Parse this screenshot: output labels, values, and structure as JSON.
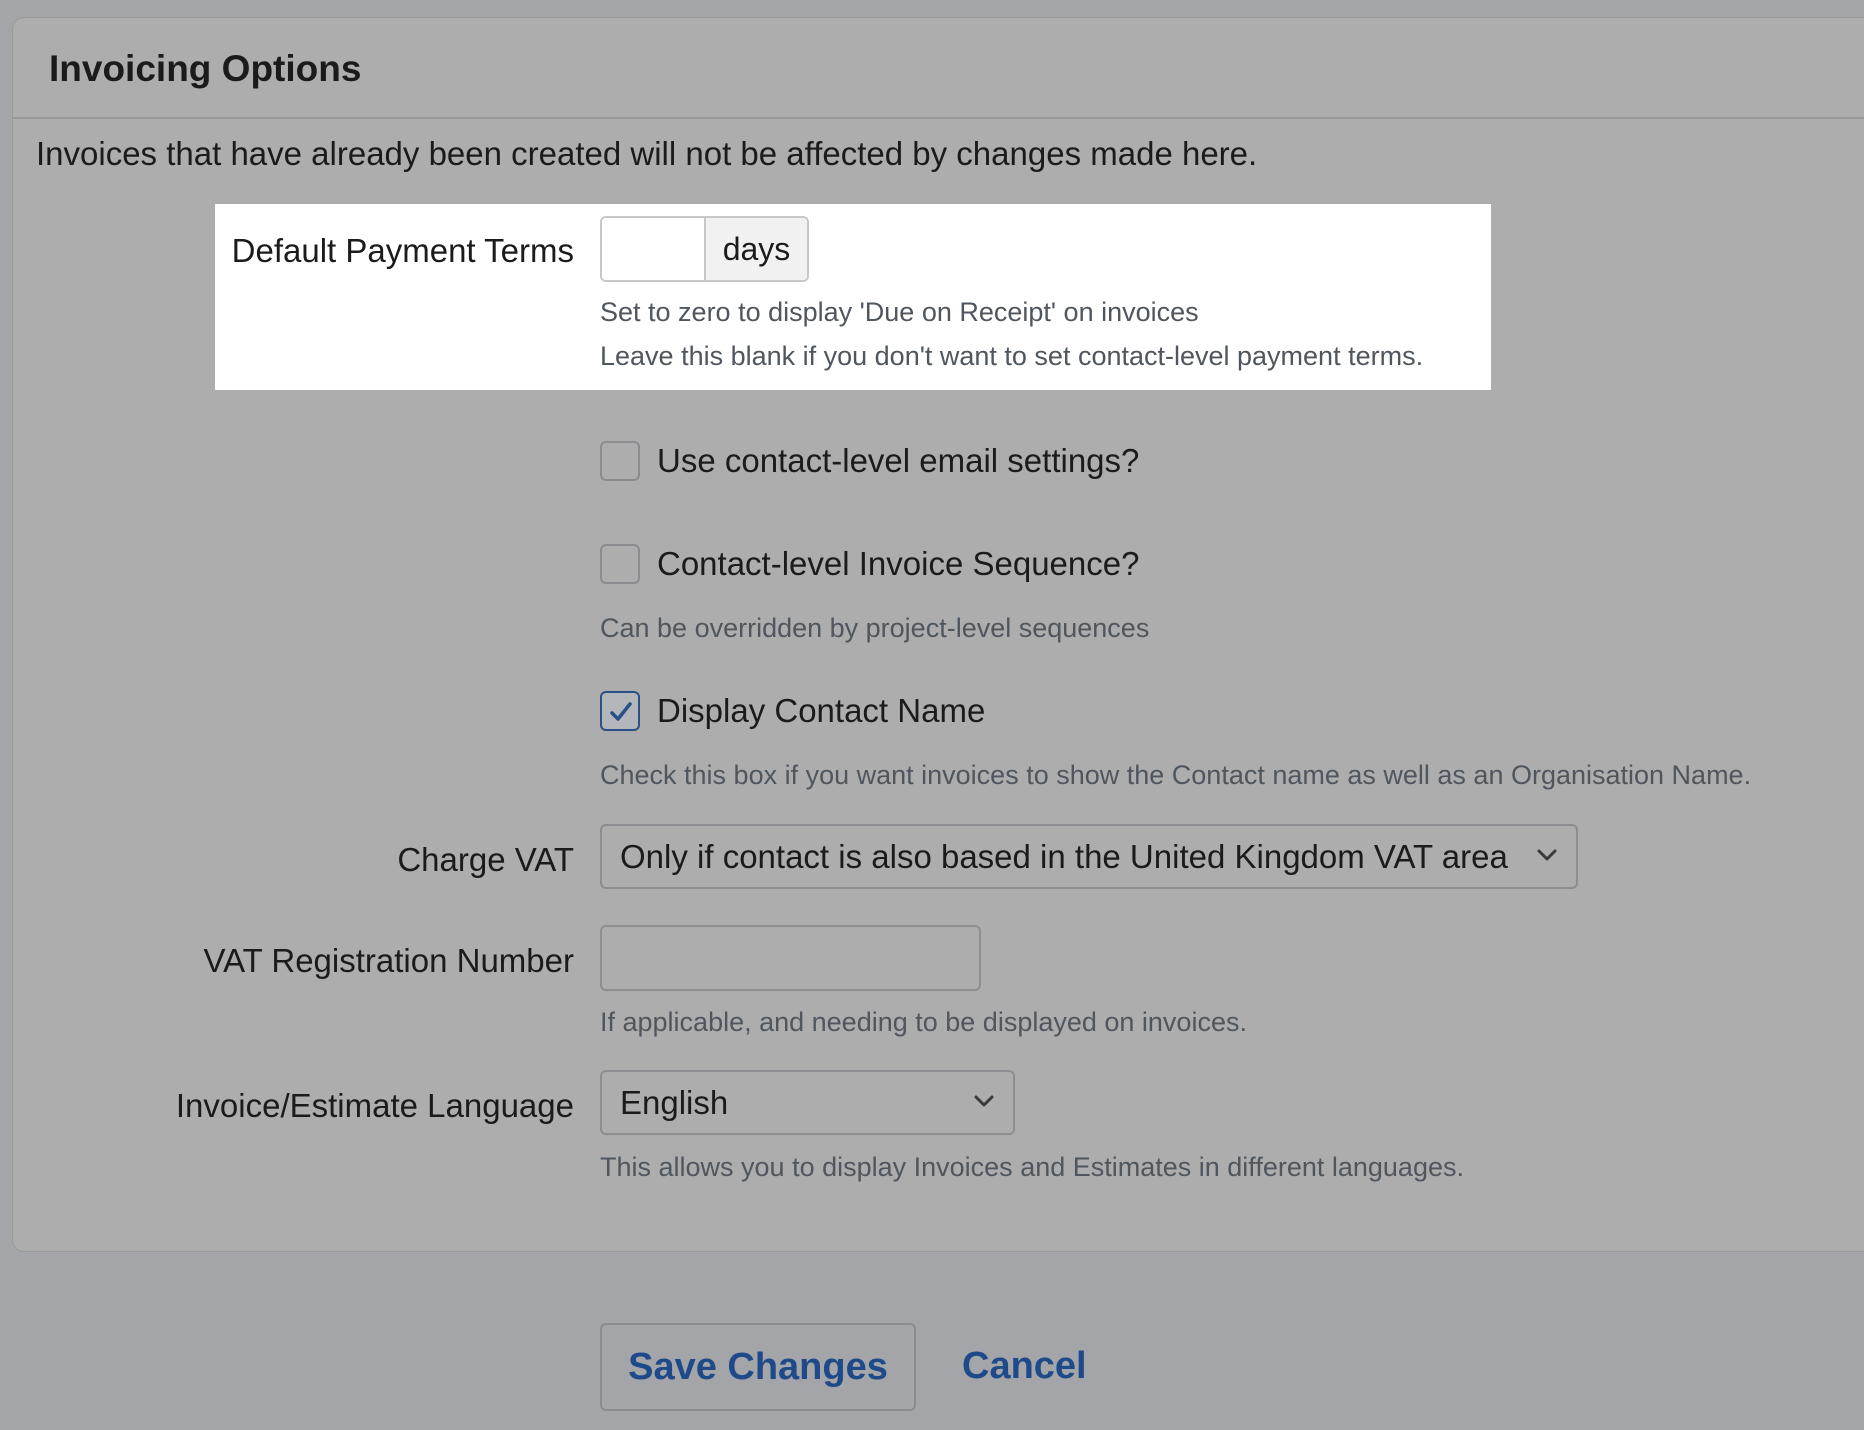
{
  "panel": {
    "title": "Invoicing Options",
    "intro": "Invoices that have already been created will not be affected by changes made here."
  },
  "payment_terms": {
    "label": "Default Payment Terms",
    "value": "",
    "addon": "days",
    "help1": "Set to zero to display 'Due on Receipt' on invoices",
    "help2": "Leave this blank if you don't want to set contact-level payment terms."
  },
  "email_settings": {
    "label": "Use contact-level email settings?",
    "checked": false
  },
  "invoice_sequence": {
    "label": "Contact-level Invoice Sequence?",
    "checked": false,
    "help": "Can be overridden by project-level sequences"
  },
  "display_contact": {
    "label": "Display Contact Name",
    "checked": true,
    "help": "Check this box if you want invoices to show the Contact name as well as an Organisation Name."
  },
  "charge_vat": {
    "label": "Charge VAT",
    "selected": "Only if contact is also based in the United Kingdom VAT area"
  },
  "vat_number": {
    "label": "VAT Registration Number",
    "value": "",
    "help": "If applicable, and needing to be displayed on invoices."
  },
  "language": {
    "label": "Invoice/Estimate Language",
    "selected": "English",
    "help": "This allows you to display Invoices and Estimates in different languages."
  },
  "actions": {
    "save": "Save Changes",
    "cancel": "Cancel"
  },
  "colors": {
    "link": "#1f4a8a",
    "check": "#2a4f86"
  },
  "icons": {
    "checkmark": "checkmark-icon",
    "chevron": "chevron-down-icon"
  }
}
